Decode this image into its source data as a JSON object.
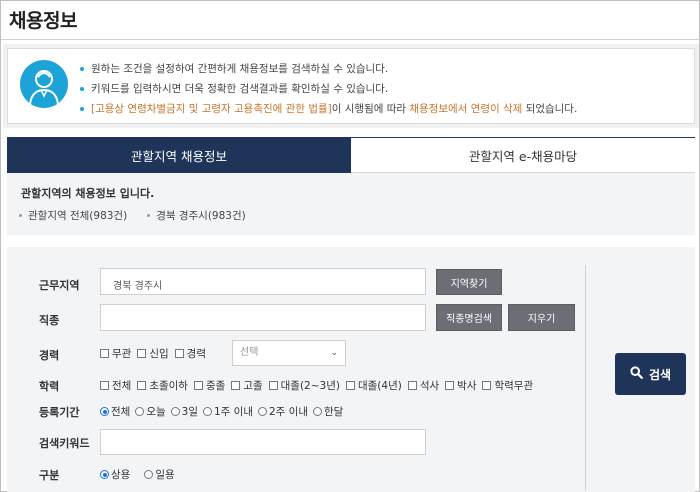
{
  "page": {
    "title": "채용정보"
  },
  "notice": {
    "line1": "원하는 조건을 설정하여 간편하게 채용정보를 검색하실 수 있습니다.",
    "line2": "키워드를 입력하시면 더욱 정확한 검색결과를 확인하실 수 있습니다.",
    "line3_law": "[고용상 연령차별금지 및 고령자 고용촉진에 관한 법률]",
    "line3_mid": "이 시행됨에 따라 ",
    "line3_emph": "채용정보에서 연령이 삭제",
    "line3_end": " 되었습니다."
  },
  "tabs": [
    {
      "label": "관할지역 채용정보",
      "active": true
    },
    {
      "label": "관할지역 e-채용마당",
      "active": false
    }
  ],
  "region": {
    "title": "관할지역의 채용정보 입니다.",
    "links": [
      "관할지역 전체(983건)",
      "경북 경주시(983건)"
    ]
  },
  "form": {
    "work_area": {
      "label": "근무지역",
      "value": "경북 경주시",
      "find_button": "지역찾기"
    },
    "job": {
      "label": "직종",
      "value": "",
      "search_button": "직종명검색",
      "clear_button": "지우기"
    },
    "career": {
      "label": "경력",
      "options": [
        "무관",
        "신입",
        "경력"
      ],
      "select_placeholder": "선택"
    },
    "education": {
      "label": "학력",
      "options": [
        "전체",
        "초졸이하",
        "중졸",
        "고졸",
        "대졸(2~3년)",
        "대졸(4년)",
        "석사",
        "박사",
        "학력무관"
      ]
    },
    "period": {
      "label": "등록기간",
      "options": [
        "전체",
        "오늘",
        "3일",
        "1주 이내",
        "2주 이내",
        "한달"
      ],
      "selected": "전체"
    },
    "keyword": {
      "label": "검색키워드",
      "value": ""
    },
    "type": {
      "label": "구분",
      "options": [
        "상용",
        "일용"
      ],
      "selected": "상용"
    },
    "search_button": "검색"
  },
  "colors": {
    "navy": "#1f3459",
    "accent_blue": "#1ca4d8",
    "gray_button": "#6b6f75",
    "orange_text": "#c7742a"
  }
}
